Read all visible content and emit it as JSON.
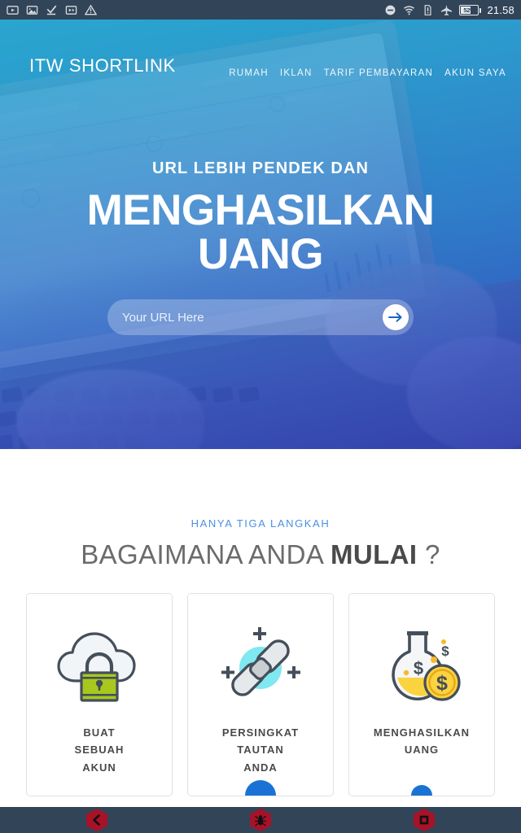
{
  "statusbar": {
    "left_icons": [
      "video-icon",
      "image-icon",
      "download-complete-icon",
      "screenshot-icon",
      "warning-icon"
    ],
    "right_icons": [
      "do-not-disturb-icon",
      "wifi-icon",
      "sim-card-icon",
      "airplane-mode-icon"
    ],
    "battery_percent": "52%",
    "battery_level": 52,
    "time": "21.58"
  },
  "hero": {
    "brand": "ITW SHORTLINK",
    "nav": [
      {
        "label": "RUMAH",
        "name": "nav-item-rumah"
      },
      {
        "label": "IKLAN",
        "name": "nav-item-iklan"
      },
      {
        "label": "TARIF PEMBAYARAN",
        "name": "nav-item-tarif-pembayaran"
      },
      {
        "label": "AKUN SAYA",
        "name": "nav-item-akun-saya"
      }
    ],
    "kicker": "URL LEBIH PENDEK DAN",
    "headline_line1": "MENGHASILKAN",
    "headline_line2": "UANG",
    "url_input_placeholder": "Your URL Here",
    "url_input_value": "",
    "go_icon": "arrow-right-icon"
  },
  "steps": {
    "kicker": "HANYA TIGA LANGKAH",
    "title_normal": "BAGAIMANA ANDA ",
    "title_bold": "MULAI",
    "title_suffix": " ?",
    "cards": [
      {
        "title": "BUAT\nSEBUAH\nAKUN",
        "icon": "cloud-lock-icon",
        "name": "step-card-buat-sebuah-akun"
      },
      {
        "title": "PERSINGKAT\nTAUTAN\nANDA",
        "icon": "chain-link-icon",
        "name": "step-card-persingkat-tautan-anda"
      },
      {
        "title": "MENGHASILKAN\nUANG",
        "icon": "money-flask-icon",
        "name": "step-card-menghasilkan-uang"
      }
    ]
  },
  "navbar": {
    "buttons": [
      {
        "name": "nav-back-button",
        "icon": "back-chevron-icon"
      },
      {
        "name": "nav-home-button",
        "icon": "bug-home-icon"
      },
      {
        "name": "nav-recents-button",
        "icon": "square-recents-icon"
      }
    ]
  },
  "colors": {
    "status_bar": "#324458",
    "hero_top": "#29a6ce",
    "hero_bottom": "#303eb2",
    "accent_blue": "#4a90e2",
    "button_blue": "#1a73d4",
    "lock_green": "#a8c81e",
    "coin_yellow": "#f5c53d",
    "link_cyan": "#7fe8f0",
    "nav_red": "#a81228"
  }
}
